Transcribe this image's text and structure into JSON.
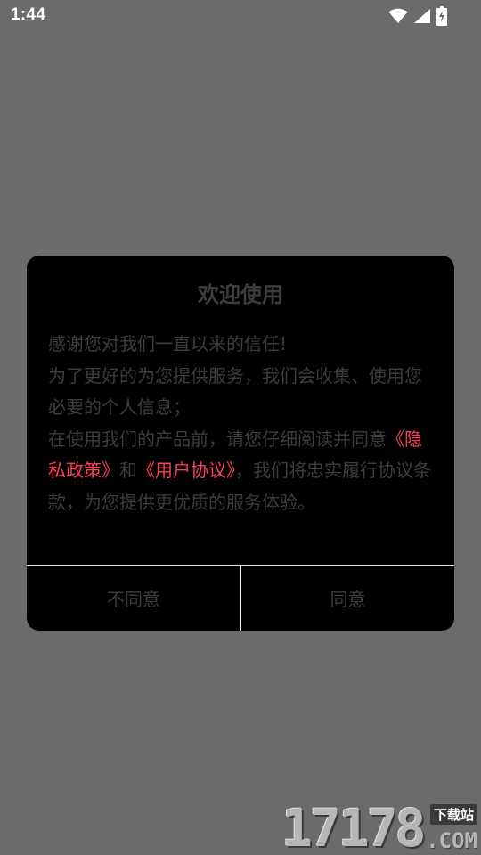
{
  "status_bar": {
    "time": "1:44",
    "icons": [
      "wifi-icon",
      "cellular-signal-icon",
      "battery-charging-icon"
    ]
  },
  "dialog": {
    "title": "欢迎使用",
    "body": {
      "line1": "感谢您对我们一直以来的信任!",
      "line2": "为了更好的为您提供服务，我们会收集、使用您必要的个人信息；",
      "line3_before": "在使用我们的产品前，请您仔细阅读并同意",
      "privacy_link": "《隐私政策》",
      "conjunction": "和",
      "agreement_link": "《用户协议》",
      "line3_after": "，我们将忠实履行协议条款，为您提供更优质的服务体验。"
    },
    "decline_label": "不同意",
    "agree_label": "同意"
  },
  "watermark": {
    "number": "17178",
    "tag": "下载站",
    "suffix": ".COM"
  },
  "colors": {
    "backdrop": "#6b6b6b",
    "dialog_bg": "#000000",
    "link": "#ff3d57",
    "text": "#3d3d3d",
    "divider": "#e6e6e6"
  }
}
